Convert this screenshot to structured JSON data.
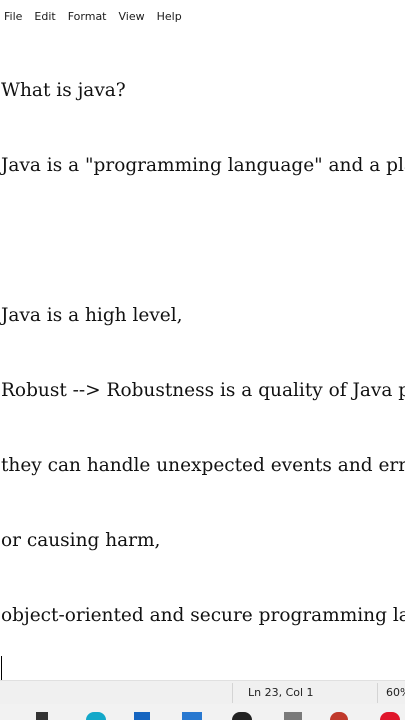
{
  "menu": [
    "File",
    "Edit",
    "Format",
    "View",
    "Help"
  ],
  "document": {
    "lines": [
      "What is java?",
      "Java is a \"programming language\" and a platform.",
      "",
      "Java is a high level,",
      "Robust --> Robustness is a quality of Java programs,",
      "they can handle unexpected events and errors without crashing",
      "or causing harm,",
      "object-oriented and secure programming language."
    ]
  },
  "status": {
    "position": "Ln 23, Col 1",
    "zoom": "60%"
  },
  "colors": {
    "taskbar_icons": [
      "#333333",
      "#13a8c9",
      "#1565c0",
      "#2878d0",
      "#222222",
      "#7a7a7a",
      "#c0392b",
      "#e0162b"
    ]
  }
}
